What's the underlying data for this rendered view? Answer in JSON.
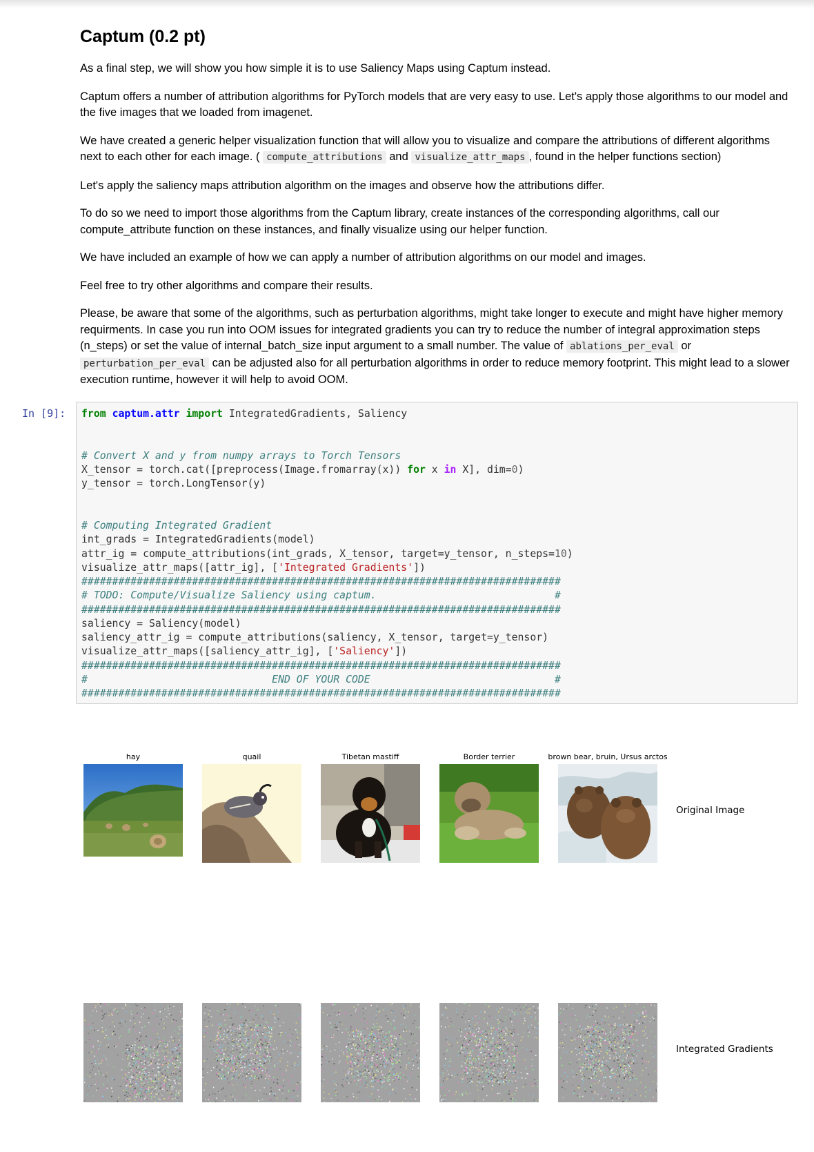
{
  "markdown": {
    "heading": "Captum (0.2 pt)",
    "p1": "As a final step, we will show you how simple it is to use Saliency Maps using Captum instead.",
    "p2": "Captum offers a number of attribution algorithms for PyTorch models that are very easy to use. Let's apply those algorithms to our model and the five images that we loaded from imagenet.",
    "p3_a": "We have created a generic helper visualization function that will allow you to visualize and compare the attributions of different algorithms next to each other for each image. (",
    "p3_code1": "compute_attributions",
    "p3_and": "and",
    "p3_code2": "visualize_attr_maps",
    "p3_b": ", found in the helper functions section)",
    "p4": "Let's apply the saliency maps attribution algorithm on the images and observe how the attributions differ.",
    "p5": "To do so we need to import those algorithms from the Captum library, create instances of the corresponding algorithms, call our compute_attribute function on these instances, and finally visualize using our helper function.",
    "p6": "We have included an example of how we can apply a number of attribution algorithms on our model and images.",
    "p7": "Feel free to try other algorithms and compare their results.",
    "p8_a": "Please, be aware that some of the algorithms, such as perturbation algorithms, might take longer to execute and might have higher memory requirments. In case you run into OOM issues for integrated gradients you can try to reduce the number of integral approximation steps (n_steps) or set the value of internal_batch_size input argument to a small number. The value of",
    "p8_code1": "ablations_per_eval",
    "p8_or": "or",
    "p8_code2": "perturbation_per_eval",
    "p8_b": "can be adjusted also for all perturbation algorithms in order to reduce memory footprint. This might lead to a slower execution runtime, however it will help to avoid OOM."
  },
  "cell": {
    "prompt": "In [9]:",
    "lines": [
      [
        [
          "kw",
          "from"
        ],
        [
          "t",
          " "
        ],
        [
          "mod",
          "captum.attr"
        ],
        [
          "t",
          " "
        ],
        [
          "kw",
          "import"
        ],
        [
          "t",
          " IntegratedGradients, Saliency"
        ]
      ],
      [],
      [],
      [
        [
          "cm",
          "# Convert X and y from numpy arrays to Torch Tensors"
        ]
      ],
      [
        [
          "t",
          "X_tensor = torch.cat([preprocess(Image.fromarray(x)) "
        ],
        [
          "kw",
          "for"
        ],
        [
          "t",
          " x "
        ],
        [
          "ow",
          "in"
        ],
        [
          "t",
          " X], dim="
        ],
        [
          "nu",
          "0"
        ],
        [
          "t",
          ")"
        ]
      ],
      [
        [
          "t",
          "y_tensor = torch.LongTensor(y)"
        ]
      ],
      [],
      [],
      [
        [
          "cm",
          "# Computing Integrated Gradient"
        ]
      ],
      [
        [
          "t",
          "int_grads = IntegratedGradients(model)"
        ]
      ],
      [
        [
          "t",
          "attr_ig = compute_attributions(int_grads, X_tensor, target=y_tensor, n_steps="
        ],
        [
          "nu",
          "10"
        ],
        [
          "t",
          ")"
        ]
      ],
      [
        [
          "t",
          "visualize_attr_maps([attr_ig], ["
        ],
        [
          "st",
          "'Integrated Gradients'"
        ],
        [
          "t",
          "])"
        ]
      ],
      [
        [
          "cm",
          "##############################################################################"
        ]
      ],
      [
        [
          "cm",
          "# TODO: Compute/Visualize Saliency using captum.                             #"
        ]
      ],
      [
        [
          "cm",
          "##############################################################################"
        ]
      ],
      [
        [
          "t",
          "saliency = Saliency(model)"
        ]
      ],
      [
        [
          "t",
          "saliency_attr_ig = compute_attributions(saliency, X_tensor, target=y_tensor)"
        ]
      ],
      [
        [
          "t",
          "visualize_attr_maps([saliency_attr_ig], ["
        ],
        [
          "st",
          "'Saliency'"
        ],
        [
          "t",
          "])"
        ]
      ],
      [
        [
          "cm",
          "##############################################################################"
        ]
      ],
      [
        [
          "cm",
          "#                              END OF YOUR CODE                              #"
        ]
      ],
      [
        [
          "cm",
          "##############################################################################"
        ]
      ]
    ]
  },
  "figure": {
    "titles": [
      "hay",
      "quail",
      "Tibetan mastiff",
      "Border terrier",
      "brown bear, bruin, Ursus arctos"
    ],
    "row_labels": [
      "Original Image",
      "Integrated Gradients"
    ],
    "colors": {
      "sky": "#3f86d9",
      "grass": "#6f8f3a",
      "quail_bg": "#fdf7da",
      "rock": "#9c8468",
      "dog_black": "#1a1410",
      "terrier": "#a98f6b",
      "water": "#e6ecef",
      "bear": "#6b4a2e",
      "noise_bg": "#a2a2a2"
    }
  }
}
